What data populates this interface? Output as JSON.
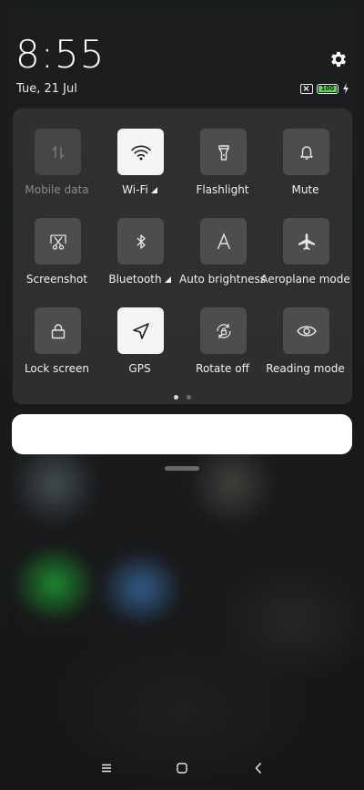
{
  "status": {
    "time": "8:55",
    "date": "Tue, 21 Jul",
    "battery_level": "100",
    "battery_charging": true
  },
  "quick_settings": {
    "tiles": [
      {
        "id": "mobile-data",
        "label": "Mobile data",
        "icon": "mobile-data-icon",
        "state": "disabled"
      },
      {
        "id": "wifi",
        "label": "Wi-Fi",
        "icon": "wifi-icon",
        "state": "on",
        "expandable": true
      },
      {
        "id": "flashlight",
        "label": "Flashlight",
        "icon": "flashlight-icon",
        "state": "off"
      },
      {
        "id": "mute",
        "label": "Mute",
        "icon": "bell-icon",
        "state": "off"
      },
      {
        "id": "screenshot",
        "label": "Screenshot",
        "icon": "scissors-icon",
        "state": "off"
      },
      {
        "id": "bluetooth",
        "label": "Bluetooth",
        "icon": "bluetooth-icon",
        "state": "off",
        "expandable": true
      },
      {
        "id": "auto-brightness",
        "label": "Auto brightness",
        "icon": "letter-a-icon",
        "state": "off"
      },
      {
        "id": "aeroplane-mode",
        "label": "Aeroplane mode",
        "icon": "airplane-icon",
        "state": "off"
      },
      {
        "id": "lock-screen",
        "label": "Lock screen",
        "icon": "lock-icon",
        "state": "off"
      },
      {
        "id": "gps",
        "label": "GPS",
        "icon": "location-arrow-icon",
        "state": "on"
      },
      {
        "id": "rotate-off",
        "label": "Rotate off",
        "icon": "rotate-lock-icon",
        "state": "off"
      },
      {
        "id": "reading-mode",
        "label": "Reading mode",
        "icon": "eye-icon",
        "state": "off"
      }
    ],
    "pages": {
      "count": 2,
      "current": 1
    }
  },
  "colors": {
    "tile_on": "#f4f4f4",
    "tile_off": "#4d4d4d",
    "battery": "#6dd05a"
  }
}
